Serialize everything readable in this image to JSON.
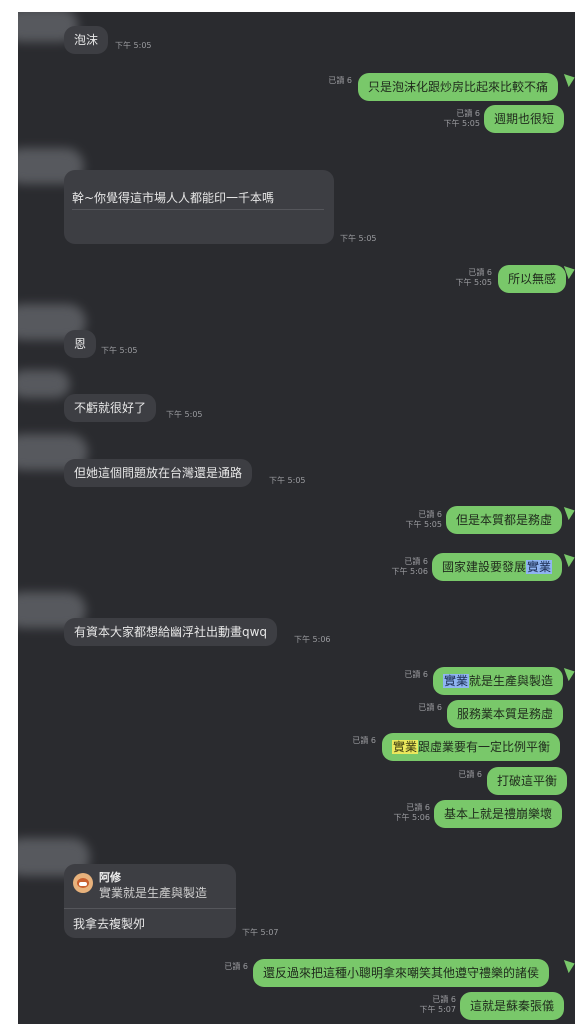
{
  "status": {
    "read6": "已讀 6",
    "time": "下午 5:05",
    "time506": "下午 5:06",
    "time507": "下午 5:07"
  },
  "messages": {
    "m1": "泡沫",
    "m2": "只是泡沫化跟炒房比起來比較不痛",
    "m3": "週期也很短",
    "m4": "幹~你覺得這市場人人都能印一千本嗎",
    "m5": "所以無感",
    "m6": "恩",
    "m7": "不虧就很好了",
    "m8": "但她這個問題放在台灣還是通路",
    "m9": "但是本質都是務虛",
    "m10_pre": "國家建設要發展",
    "m10_hl": "實業",
    "m11": "有資本大家都想給幽浮社出動畫qwq",
    "m12_hl": "實業",
    "m12_post": "就是生產與製造",
    "m13": "服務業本質是務虛",
    "m14_hl": "實業",
    "m14_post": "跟虛業要有一定比例平衡",
    "m15": "打破這平衡",
    "m16": "基本上就是禮崩樂壞",
    "m17_reply_name": "阿修",
    "m17_reply_text": "實業就是生產與製造",
    "m17": "我拿去複製夘",
    "m18": "還反過來把這種小聰明拿來嘲笑其他遵守禮樂的諸侯",
    "m19": "這就是蘇秦張儀"
  },
  "colors": {
    "background": "#2a2b2f",
    "incoming": "#3d3e43",
    "outgoing": "#79c86a",
    "highlight_blue": "#8fb4f2",
    "highlight_yellow": "#ebe85c"
  },
  "icons": {
    "avatar": "blurred-avatar-icon",
    "reply_avatar": "user-avatar-icon"
  }
}
